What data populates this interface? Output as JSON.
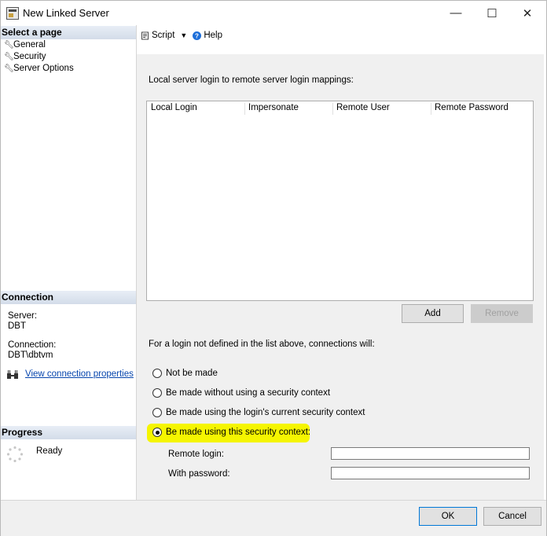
{
  "window": {
    "title": "New Linked Server",
    "minimize": "—",
    "maximize": "☐",
    "close": "✕",
    "app_icon": "linked-server-icon"
  },
  "left_pane": {
    "select_page_header": "Select a page",
    "pages": [
      {
        "label": "General",
        "icon": "wrench-icon"
      },
      {
        "label": "Security",
        "icon": "wrench-icon"
      },
      {
        "label": "Server Options",
        "icon": "wrench-icon"
      }
    ],
    "connection_header": "Connection",
    "server_label": "Server:",
    "server_value": "DBT",
    "connection_label": "Connection:",
    "connection_value": "DBT\\dbtvm",
    "view_connection_properties": "View connection properties",
    "progress_header": "Progress",
    "progress_status": "Ready"
  },
  "toolbar": {
    "script_label": "Script",
    "help_label": "Help"
  },
  "security": {
    "mappings_label": "Local server login to remote server login mappings:",
    "columns": [
      "Local Login",
      "Impersonate",
      "Remote User",
      "Remote Password"
    ],
    "add_button": "Add",
    "remove_button": "Remove",
    "not_defined_label": "For a login not defined in the list above, connections will:",
    "options": [
      {
        "label": "Not be made",
        "checked": false
      },
      {
        "label": "Be made without using a security context",
        "checked": false
      },
      {
        "label": "Be made using the login's current security context",
        "checked": false
      },
      {
        "label": "Be made using this security context:",
        "checked": true
      }
    ],
    "remote_login_label": "Remote login:",
    "remote_login_value": "",
    "with_password_label": "With password:",
    "with_password_value": ""
  },
  "footer": {
    "ok_button": "OK",
    "cancel_button": "Cancel"
  },
  "colors": {
    "highlight": "#f5f500",
    "section_header": "#d3dce9",
    "link": "#0645ad"
  }
}
